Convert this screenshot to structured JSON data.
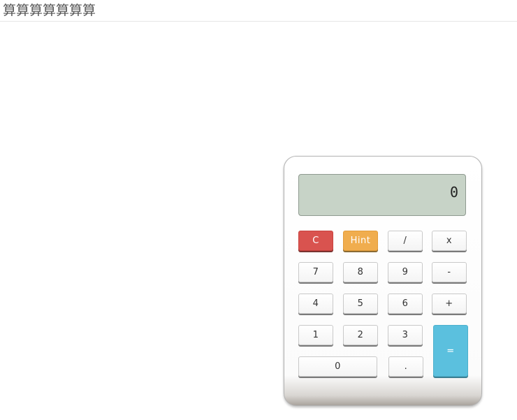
{
  "page": {
    "title": "算算算算算算算"
  },
  "display": {
    "value": "0"
  },
  "keys": {
    "clear": "C",
    "hint": "Hint",
    "divide": "/",
    "multiply": "x",
    "seven": "7",
    "eight": "8",
    "nine": "9",
    "minus": "-",
    "four": "4",
    "five": "5",
    "six": "6",
    "plus": "+",
    "one": "1",
    "two": "2",
    "three": "3",
    "equals": "=",
    "zero": "0",
    "decimal": "."
  },
  "colors": {
    "display_bg": "#c7d3c7",
    "clear": "#d9534f",
    "hint": "#f0ad4e",
    "equals": "#5bc0de"
  }
}
